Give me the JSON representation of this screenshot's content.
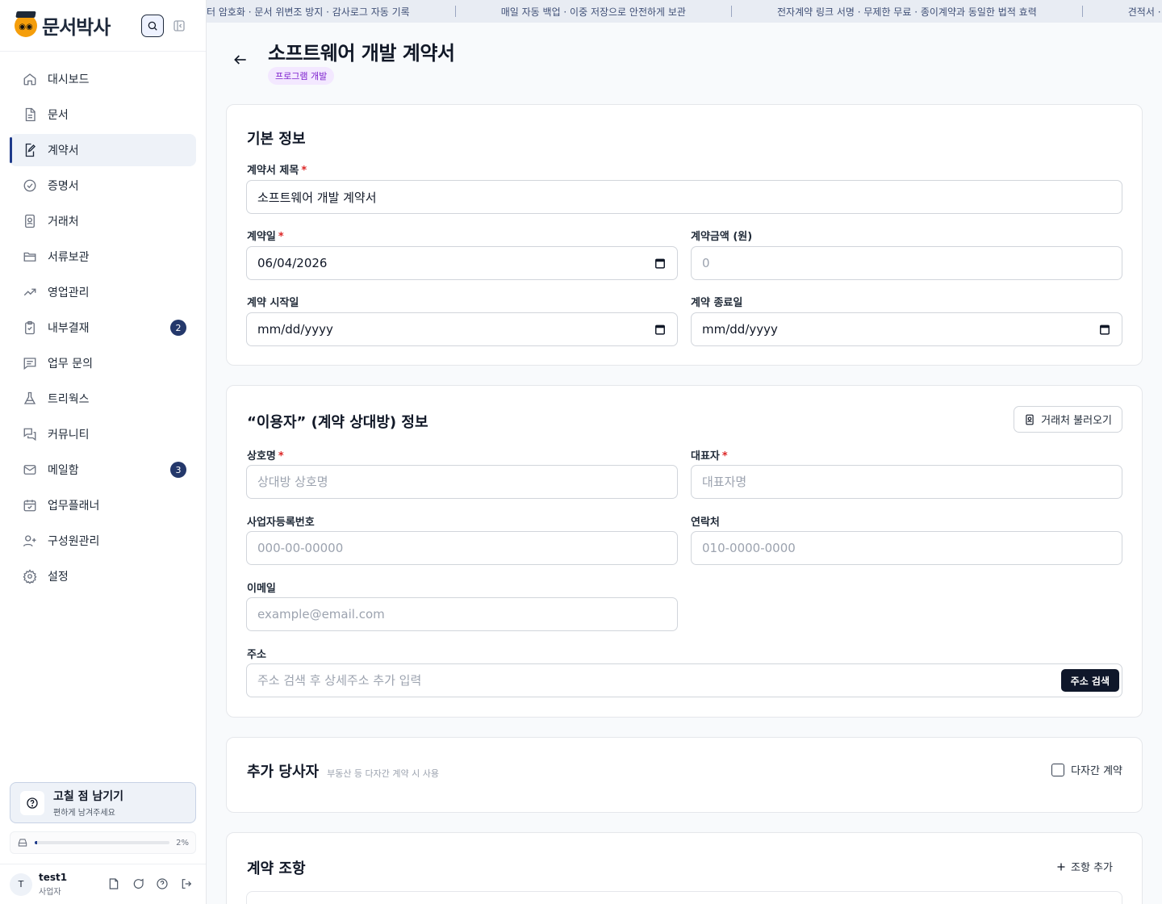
{
  "app": {
    "logo_text": "문서박사",
    "search_icon": "search-icon",
    "collapse_icon": "sidebar-collapse-icon"
  },
  "sidebar": {
    "items": [
      {
        "label": "대시보드",
        "icon": "home-icon"
      },
      {
        "label": "문서",
        "icon": "document-icon"
      },
      {
        "label": "계약서",
        "icon": "contract-edit-icon",
        "active": true
      },
      {
        "label": "증명서",
        "icon": "badge-check-icon"
      },
      {
        "label": "거래처",
        "icon": "contact-book-icon"
      },
      {
        "label": "서류보관",
        "icon": "folder-icon"
      },
      {
        "label": "영업관리",
        "icon": "trending-up-icon"
      },
      {
        "label": "내부결재",
        "icon": "clipboard-check-icon",
        "badge": "2"
      },
      {
        "label": "업무 문의",
        "icon": "message-square-icon"
      },
      {
        "label": "트리웍스",
        "icon": "flask-icon"
      },
      {
        "label": "커뮤니티",
        "icon": "chat-bubbles-icon"
      },
      {
        "label": "메일함",
        "icon": "mail-icon",
        "badge": "3"
      },
      {
        "label": "업무플래너",
        "icon": "calendar-check-icon"
      },
      {
        "label": "구성원관리",
        "icon": "user-plus-icon"
      },
      {
        "label": "설정",
        "icon": "gear-icon"
      }
    ],
    "feedback": {
      "title": "고칠 점 남기기",
      "subtitle": "편하게 남겨주세요"
    },
    "storage": {
      "percent_label": "2%",
      "percent": 2
    },
    "user": {
      "initial": "T",
      "name": "test1",
      "role": "사업자"
    }
  },
  "ticker": {
    "items": [
      "터 암호화 · 문서 위변조 방지 · 감사로그 자동 기록",
      "매일 자동 백업 · 이중 저장으로 안전하게 보관",
      "전자계약 링크 서명 · 무제한 무료 · 종이계약과 동일한 법적 효력",
      "견적서 · 계약서 · 증"
    ]
  },
  "page": {
    "title": "소프트웨어 개발 계약서",
    "tag": "프로그램 개발"
  },
  "basic": {
    "title": "기본 정보",
    "contract_title_label": "계약서 제목",
    "contract_title_value": "소프트웨어 개발 계약서",
    "contract_date_label": "계약일",
    "contract_date_value": "06/04/2026",
    "amount_label": "계약금액 (원)",
    "amount_placeholder": "0",
    "start_label": "계약 시작일",
    "start_value": "mm/dd/yyyy",
    "end_label": "계약 종료일",
    "end_value": "mm/dd/yyyy"
  },
  "party": {
    "title": "“이용자” (계약 상대방) 정보",
    "import_button": "거래처 불러오기",
    "company_label": "상호명",
    "company_placeholder": "상대방 상호명",
    "rep_label": "대표자",
    "rep_placeholder": "대표자명",
    "bizno_label": "사업자등록번호",
    "bizno_placeholder": "000-00-00000",
    "phone_label": "연락처",
    "phone_placeholder": "010-0000-0000",
    "email_label": "이메일",
    "email_placeholder": "example@email.com",
    "address_label": "주소",
    "address_placeholder": "주소 검색 후 상세주소 추가 입력",
    "address_button": "주소 검색"
  },
  "extra": {
    "title": "추가 당사자",
    "hint": "부동산 등 다자간 계약 시 사용",
    "checkbox_label": "다자간 계약"
  },
  "clauses": {
    "title": "계약 조항",
    "add_button": "조항 추가"
  }
}
